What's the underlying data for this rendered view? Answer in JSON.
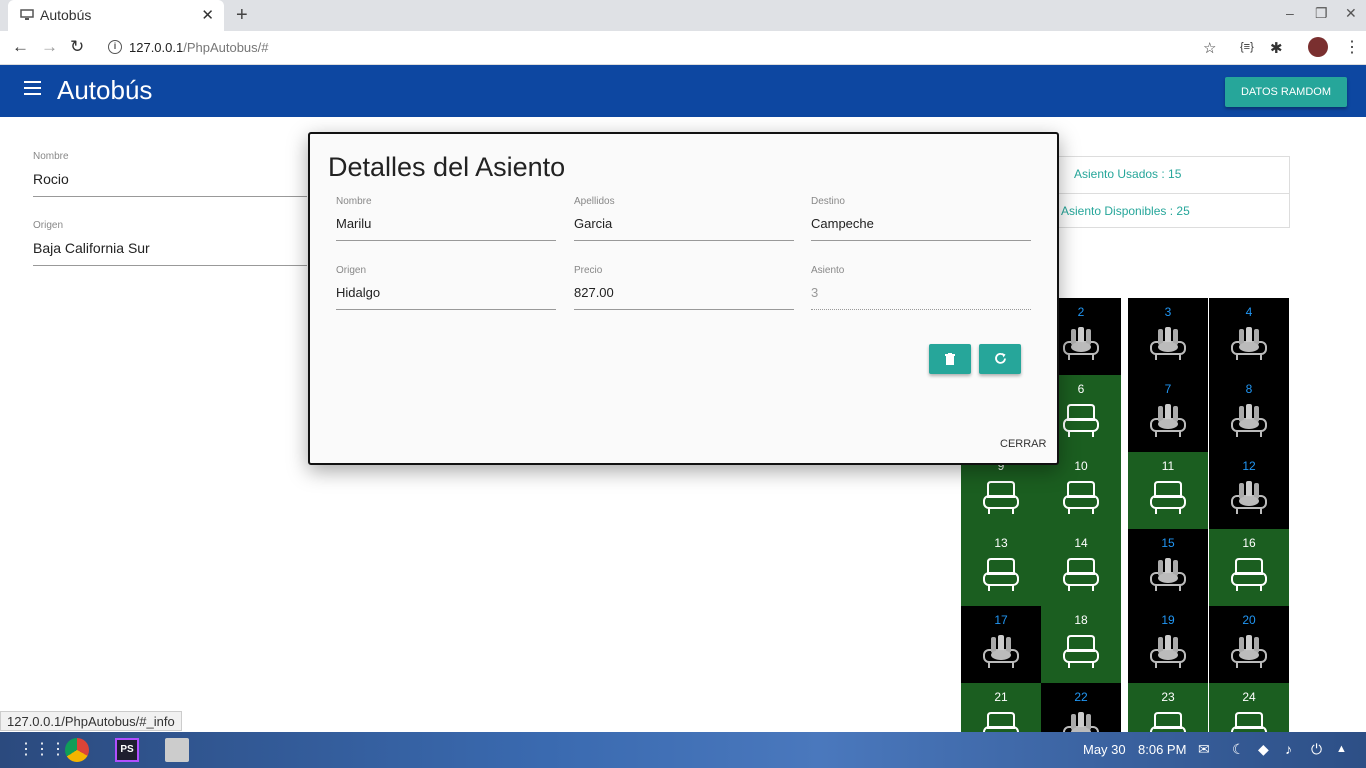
{
  "browser": {
    "tab_title": "Autobús",
    "url_host": "127.0.0.1",
    "url_path": "/PhpAutobus/#",
    "status_url": "127.0.0.1/PhpAutobus/#_info"
  },
  "app": {
    "title": "Autobús",
    "random_button": "DATOS RAMDOM"
  },
  "form": {
    "nombre_label": "Nombre",
    "nombre_value": "Rocio",
    "origen_label": "Origen",
    "origen_value": "Baja California Sur"
  },
  "stats": {
    "used": "Asiento Usados : 15",
    "available": "Asiento Disponibles : 25"
  },
  "seats": [
    {
      "n": "2",
      "state": "used"
    },
    {
      "n": "3",
      "state": "used"
    },
    {
      "n": "4",
      "state": "used"
    },
    {
      "n": "6",
      "state": "free"
    },
    {
      "n": "7",
      "state": "used"
    },
    {
      "n": "8",
      "state": "used"
    },
    {
      "n": "9",
      "state": "free"
    },
    {
      "n": "10",
      "state": "free"
    },
    {
      "n": "11",
      "state": "free"
    },
    {
      "n": "12",
      "state": "used"
    },
    {
      "n": "13",
      "state": "free"
    },
    {
      "n": "14",
      "state": "free"
    },
    {
      "n": "15",
      "state": "used"
    },
    {
      "n": "16",
      "state": "free"
    },
    {
      "n": "17",
      "state": "used"
    },
    {
      "n": "18",
      "state": "free"
    },
    {
      "n": "19",
      "state": "used"
    },
    {
      "n": "20",
      "state": "used"
    },
    {
      "n": "21",
      "state": "free"
    },
    {
      "n": "22",
      "state": "used"
    },
    {
      "n": "23",
      "state": "free"
    },
    {
      "n": "24",
      "state": "free"
    }
  ],
  "modal": {
    "title": "Detalles del Asiento",
    "nombre_label": "Nombre",
    "nombre_value": "Marilu",
    "apellidos_label": "Apellidos",
    "apellidos_value": "Garcia",
    "destino_label": "Destino",
    "destino_value": "Campeche",
    "origen_label": "Origen",
    "origen_value": "Hidalgo",
    "precio_label": "Precio",
    "precio_value": "827.00",
    "asiento_label": "Asiento",
    "asiento_value": "3",
    "close_label": "CERRAR"
  },
  "taskbar": {
    "date": "May 30",
    "time": "8:06 PM"
  },
  "colors": {
    "appbar": "#0d47a1",
    "accent": "#26a69a",
    "seat_free": "#1b5e20",
    "seat_used": "#000000"
  },
  "icons": [
    "monitor-icon",
    "close-icon",
    "plus-icon",
    "back-icon",
    "forward-icon",
    "reload-icon",
    "info-icon",
    "star-icon",
    "menu-icon",
    "seat-icon",
    "trash-icon",
    "refresh-icon"
  ]
}
